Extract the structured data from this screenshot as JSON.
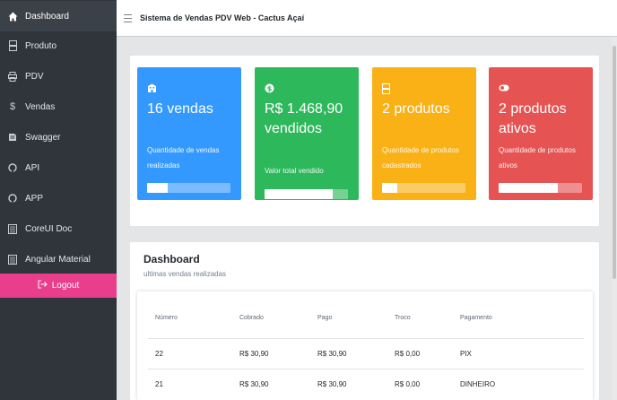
{
  "header": {
    "title": "Sistema de Vendas PDV Web - Cactus Açaí"
  },
  "sidebar": {
    "items": [
      {
        "label": "Dashboard",
        "icon": "home-icon",
        "active": true
      },
      {
        "label": "Produto",
        "icon": "product-icon"
      },
      {
        "label": "PDV",
        "icon": "printer-icon"
      },
      {
        "label": "Vendas",
        "icon": "dollar-icon"
      },
      {
        "label": "Swagger",
        "icon": "book-icon"
      },
      {
        "label": "API",
        "icon": "github-icon"
      },
      {
        "label": "APP",
        "icon": "github-icon"
      },
      {
        "label": "CoreUI Doc",
        "icon": "doc-icon"
      },
      {
        "label": "Angular Material",
        "icon": "doc-icon"
      }
    ],
    "logout_label": "Logout"
  },
  "cards": [
    {
      "value": "16 vendas",
      "label": "Quantidade de vendas realizadas",
      "color": "#3399ff",
      "icon": "building-icon",
      "progress": 0.25
    },
    {
      "value": "R$ 1.468,90 vendidos",
      "label": "Valor total vendido",
      "color": "#2eb85c",
      "icon": "dollar-circle-icon",
      "progress": 0.82
    },
    {
      "value": "2 produtos",
      "label": "Quantidade de produtos cadastrados",
      "color": "#f9b115",
      "icon": "product-icon",
      "progress": 0.18
    },
    {
      "value": "2 produtos ativos",
      "label": "Quantidade de produtos ativos",
      "color": "#e55353",
      "icon": "toggle-icon",
      "progress": 0.71
    }
  ],
  "dashboard": {
    "title": "Dashboard",
    "subtitle": "ultimas vendas realizadas",
    "columns": [
      "Número",
      "Cobrado",
      "Pago",
      "Troco",
      "Pagamento"
    ],
    "rows": [
      [
        "22",
        "R$ 30,90",
        "R$ 30,90",
        "R$ 0,00",
        "PIX"
      ],
      [
        "21",
        "R$ 30,90",
        "R$ 30,90",
        "R$ 0,00",
        "DINHEIRO"
      ]
    ]
  }
}
